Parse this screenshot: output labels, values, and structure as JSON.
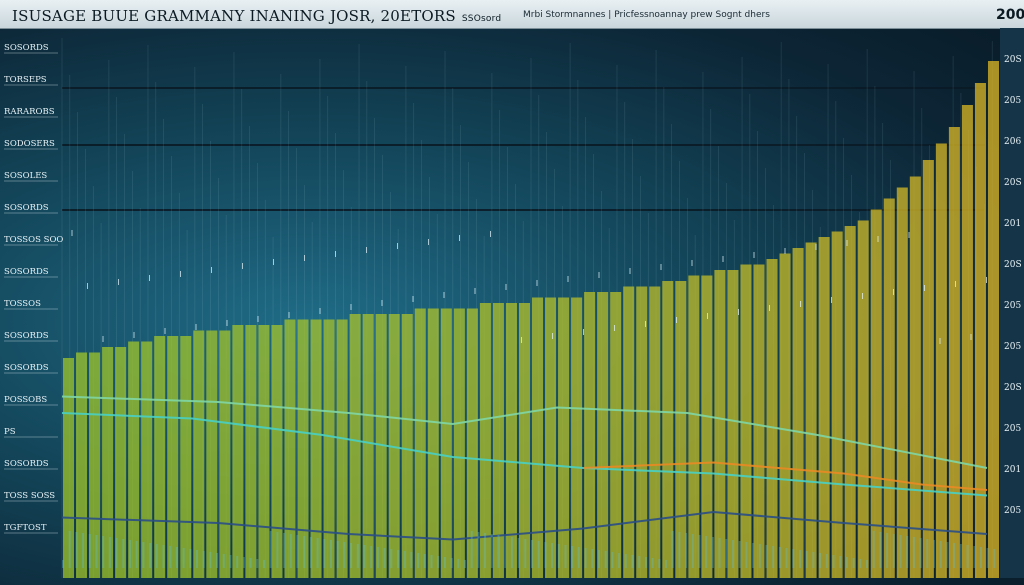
{
  "header": {
    "title": "ISUSAGE BUUE GRAMMANY INANING JOSR, 20ETORS",
    "title_small": "SSOsord",
    "subtitle": "Mrbi Stormnannes | Pricfessnoannay prew Sognt dhers",
    "corner_label": "200"
  },
  "left_axis_labels": [
    "SOSORDS",
    "TORSEPS",
    "RARAROBS",
    "SODOSERS",
    "SOSOLES",
    "SOSORDS",
    "TOSSOS SOO",
    "SOSORDS",
    "TOSSOS",
    "SOSORDS",
    "SOSORDS",
    "POSSOBS",
    "PS",
    "SOSORDS",
    "TOSS SOSS",
    "TGFTOST"
  ],
  "right_axis_labels": [
    "20S",
    "205",
    "206",
    "20S",
    "201",
    "20S",
    "205",
    "205",
    "20S",
    "205",
    "201",
    "205"
  ],
  "chart_data": {
    "type": "bar",
    "title": "ISUSAGE BUUE GRAMMANY INANING JOSR, 20ETORS",
    "x_count": 72,
    "bars": [
      {
        "name": "green",
        "color": "#9fc42a"
      },
      {
        "name": "yellow",
        "color": "#e0b824"
      }
    ],
    "values": [
      40,
      41,
      41,
      42,
      42,
      43,
      43,
      44,
      44,
      44,
      45,
      45,
      45,
      46,
      46,
      46,
      46,
      47,
      47,
      47,
      47,
      47,
      48,
      48,
      48,
      48,
      48,
      49,
      49,
      49,
      49,
      49,
      50,
      50,
      50,
      50,
      51,
      51,
      51,
      51,
      52,
      52,
      52,
      53,
      53,
      53,
      54,
      54,
      55,
      55,
      56,
      56,
      57,
      57,
      58,
      59,
      60,
      61,
      62,
      63,
      64,
      65,
      67,
      69,
      71,
      73,
      76,
      79,
      82,
      86,
      90,
      94
    ],
    "lines": [
      {
        "name": "teal-1",
        "color": "#49d0c3",
        "points": [
          [
            0,
            30
          ],
          [
            10,
            29
          ],
          [
            20,
            26
          ],
          [
            30,
            22
          ],
          [
            40,
            20
          ],
          [
            50,
            19
          ],
          [
            60,
            17
          ],
          [
            71,
            15
          ]
        ]
      },
      {
        "name": "teal-2",
        "color": "#7fd6a5",
        "points": [
          [
            0,
            33
          ],
          [
            12,
            32
          ],
          [
            22,
            30
          ],
          [
            30,
            28
          ],
          [
            38,
            31
          ],
          [
            48,
            30
          ],
          [
            58,
            26
          ],
          [
            71,
            20
          ]
        ]
      },
      {
        "name": "orange",
        "color": "#e98a23",
        "points": [
          [
            40,
            20
          ],
          [
            50,
            21
          ],
          [
            60,
            19
          ],
          [
            66,
            17
          ],
          [
            71,
            16
          ]
        ]
      },
      {
        "name": "blue",
        "color": "#2a4e86",
        "points": [
          [
            0,
            11
          ],
          [
            12,
            10
          ],
          [
            22,
            8
          ],
          [
            30,
            7
          ],
          [
            40,
            9
          ],
          [
            50,
            12
          ],
          [
            60,
            10
          ],
          [
            71,
            8
          ]
        ]
      }
    ],
    "ylim": [
      0,
      100
    ]
  },
  "colors": {
    "bg": "#0f2a3a",
    "accent": "#9fc42a",
    "highlight": "#e0b824"
  }
}
